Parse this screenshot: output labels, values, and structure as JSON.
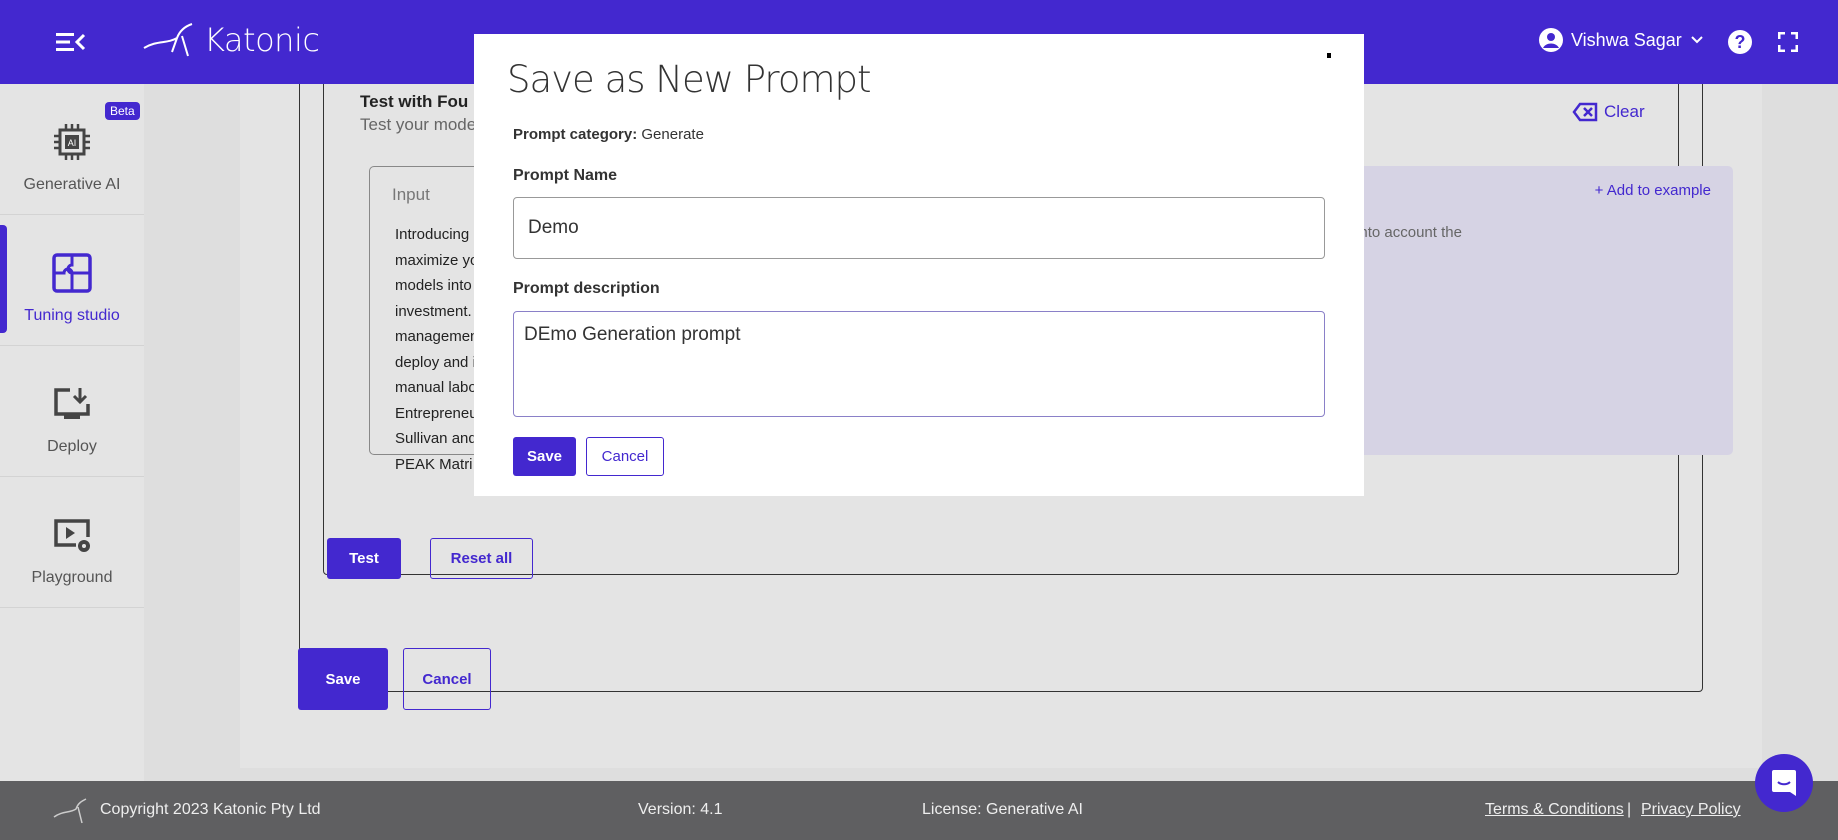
{
  "header": {
    "brand": "Katonic",
    "user_name": "Vishwa Sagar",
    "accent": "#4328cf"
  },
  "sidebar": {
    "items": [
      {
        "label": "Generative AI",
        "badge": "Beta",
        "icon": "ai-chip-icon"
      },
      {
        "label": "Tuning studio",
        "icon": "puzzle-icon",
        "active": true
      },
      {
        "label": "Deploy",
        "icon": "monitor-download-icon"
      },
      {
        "label": "Playground",
        "icon": "video-settings-icon"
      }
    ]
  },
  "test": {
    "title": "Test with Fou",
    "subtitle": "Test your model",
    "clear_label": "Clear",
    "input_heading": "Input",
    "input_text": "Introducing\nmaximize yo\nmodels into\ninvestment.\nmanagemen\ndeploy and i\nmanual labo\nEntrepreneu\nSullivan and\nPEAK Matri",
    "add_to_example": "+ Add to example",
    "output_text": "ch takes into account the\ned.",
    "test_label": "Test",
    "reset_label": "Reset all"
  },
  "page_actions": {
    "save_label": "Save",
    "cancel_label": "Cancel"
  },
  "modal": {
    "title": "Save as New Prompt",
    "category_label": "Prompt category:",
    "category_value": "Generate",
    "name_label": "Prompt Name",
    "name_value": "Demo",
    "description_label": "Prompt description",
    "description_value": "DEmo Generation prompt",
    "save_label": "Save",
    "cancel_label": "Cancel"
  },
  "footer": {
    "copyright": "Copyright 2023 Katonic Pty Ltd",
    "version": "Version: 4.1",
    "license": "License: Generative AI",
    "terms": "Terms & Conditions",
    "separator": "|",
    "privacy": "Privacy Policy"
  }
}
